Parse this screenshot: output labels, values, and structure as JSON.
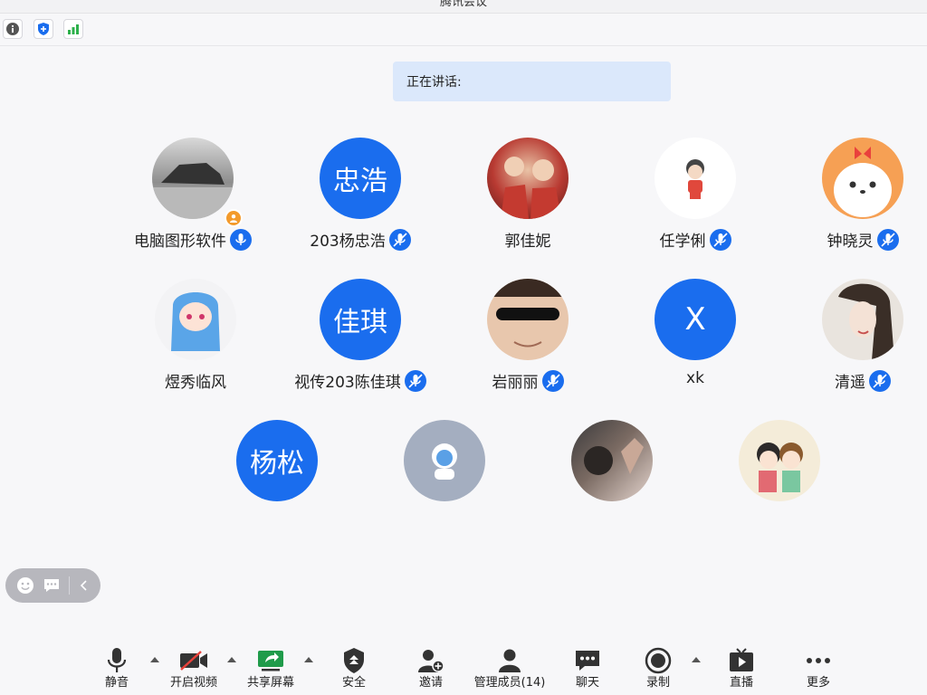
{
  "window": {
    "title": "腾讯会议"
  },
  "topbar": {
    "icons": [
      "info-icon",
      "shield-icon",
      "signal-icon"
    ]
  },
  "speaking": {
    "label": "正在讲话:"
  },
  "participants": [
    {
      "name": "电脑图形软件",
      "avatar": "photo",
      "mic": true,
      "host": true
    },
    {
      "name": "203杨忠浩",
      "avatar_text": "忠浩",
      "mic": true
    },
    {
      "name": "郭佳妮",
      "avatar": "photo",
      "mic": false
    },
    {
      "name": "任学俐",
      "avatar": "photo",
      "mic": true
    },
    {
      "name": "钟晓灵",
      "avatar": "photo",
      "mic": true
    },
    {
      "name": "煜秀临风",
      "avatar": "photo",
      "mic": false
    },
    {
      "name": "视传203陈佳琪",
      "avatar_text": "佳琪",
      "mic": true
    },
    {
      "name": "岩丽丽",
      "avatar": "photo",
      "mic": true
    },
    {
      "name": "xk",
      "avatar_text": "X",
      "mic": false
    },
    {
      "name": "清遥",
      "avatar": "photo",
      "mic": true
    },
    {
      "name": "",
      "avatar_text": "杨松",
      "mic": false
    },
    {
      "name": "",
      "avatar": "photo",
      "mic": false
    },
    {
      "name": "",
      "avatar": "photo",
      "mic": false
    },
    {
      "name": "",
      "avatar": "photo",
      "mic": false
    }
  ],
  "toolbar": {
    "mute": "静音",
    "video": "开启视频",
    "share": "共享屏幕",
    "security": "安全",
    "invite": "邀请",
    "members": "管理成员(14)",
    "chat": "聊天",
    "record": "录制",
    "live": "直播",
    "more": "更多"
  },
  "colors": {
    "accent": "#1a6dee",
    "speaking_bg": "#dbe8fb",
    "host_badge": "#f39a2b"
  }
}
